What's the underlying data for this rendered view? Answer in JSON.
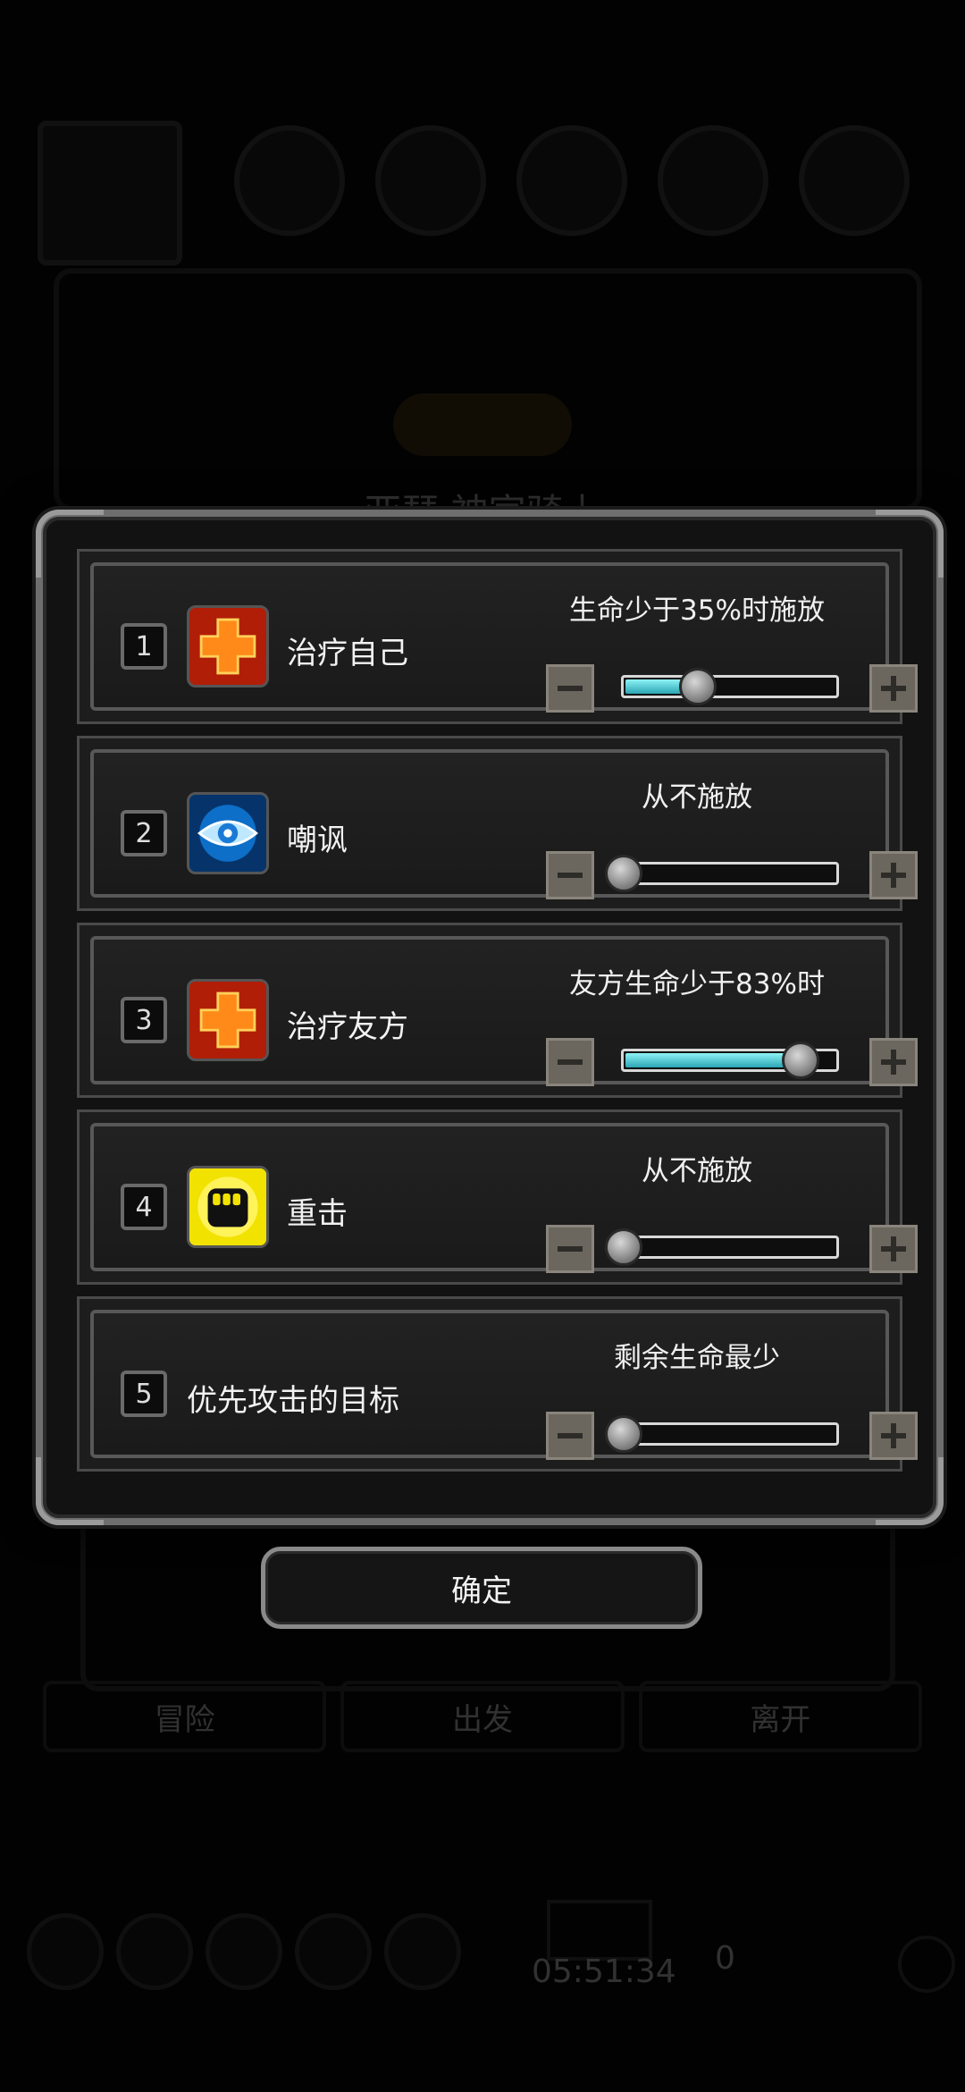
{
  "background": {
    "hero_title": "亚瑟 神官骑士",
    "nav_buttons": [
      "冒险",
      "出发",
      "离开"
    ],
    "timer": "05:51:34",
    "coin_count": "0"
  },
  "rows": [
    {
      "number": "1",
      "icon": "heal-cross-icon",
      "name": "治疗自己",
      "condition": "生命少于35%时施放",
      "level": 0.35
    },
    {
      "number": "2",
      "icon": "eye-taunt-icon",
      "name": "嘲讽",
      "condition": "从不施放",
      "level": 0.0
    },
    {
      "number": "3",
      "icon": "heal-cross-icon",
      "name": "治疗友方",
      "condition": "友方生命少于83%时",
      "level": 0.83
    },
    {
      "number": "4",
      "icon": "fist-icon",
      "name": "重击",
      "condition": "从不施放",
      "level": 0.0
    },
    {
      "number": "5",
      "icon": "",
      "name": "优先攻击的目标",
      "condition": "剩余生命最少",
      "level": 0.0
    }
  ],
  "confirm_label": "确定",
  "colors": {
    "slider_fill": "#2aa6b4",
    "heal_icon_bg": "#c8260e",
    "taunt_icon_bg": "#0a5aa8",
    "fist_icon_bg": "#e6d400"
  }
}
